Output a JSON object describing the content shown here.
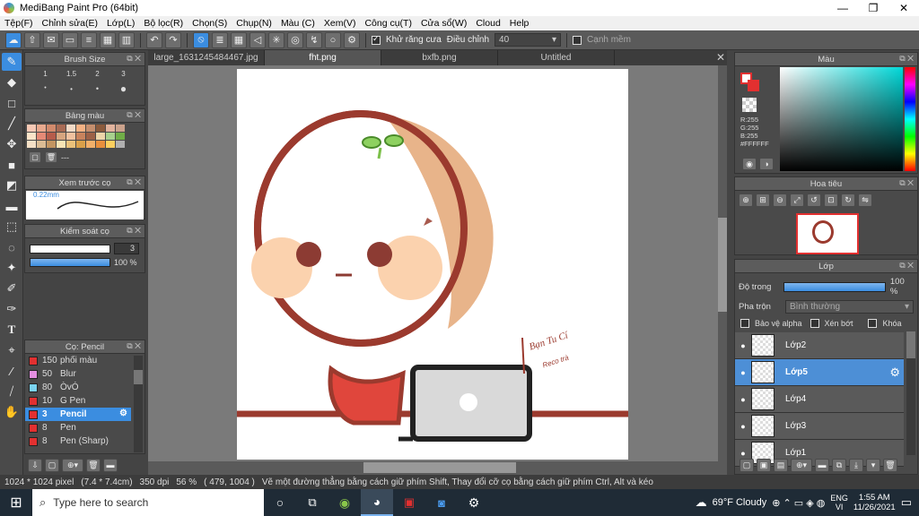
{
  "window": {
    "title": "MediBang Paint Pro (64bit)"
  },
  "menu": [
    "Tệp(F)",
    "Chỉnh sửa(E)",
    "Lớp(L)",
    "Bộ lọc(R)",
    "Chọn(S)",
    "Chụp(N)",
    "Màu (C)",
    "Xem(V)",
    "Công cụ(T)",
    "Cửa sổ(W)",
    "Cloud",
    "Help"
  ],
  "toolbar": {
    "antialias_label": "Khử răng cưa",
    "adjust_label": "Điều chỉnh",
    "adjust_value": "40",
    "snap_label": "Cạnh mềm"
  },
  "brush_size": {
    "title": "Brush Size",
    "sizes": [
      "1",
      "1.5",
      "2",
      "3"
    ]
  },
  "palette": {
    "title": "Bảng màu",
    "dash": "---"
  },
  "brush_preview": {
    "title": "Xem trước cọ",
    "size": "0.22mm"
  },
  "brush_control": {
    "title": "Kiểm soát cọ",
    "width_value": "3",
    "opacity_value": "100 %"
  },
  "brush_list": {
    "title": "Cọ: Pencil",
    "items": [
      {
        "size": "150",
        "name": "phối màu",
        "color": "#e23030"
      },
      {
        "size": "50",
        "name": "Blur",
        "color": "#e38ee0"
      },
      {
        "size": "80",
        "name": "ÒvÓ",
        "color": "#7ad3f0"
      },
      {
        "size": "10",
        "name": "G Pen",
        "color": "#e23030"
      },
      {
        "size": "3",
        "name": "Pencil",
        "color": "#e23030"
      },
      {
        "size": "8",
        "name": "Pen",
        "color": "#e23030"
      },
      {
        "size": "8",
        "name": "Pen (Sharp)",
        "color": "#e23030"
      }
    ]
  },
  "tabs": [
    {
      "label": "large_1631245484467.jpg"
    },
    {
      "label": "fht.png"
    },
    {
      "label": "bxfb.png"
    },
    {
      "label": "Untitled"
    }
  ],
  "canvas": {
    "signature": "Bạn Tu Cí",
    "signature_sub": "Reco trà"
  },
  "color_panel": {
    "title": "Màu",
    "r": "R:255",
    "g": "G:255",
    "b": "B:255",
    "hex": "#FFFFFF"
  },
  "navigator": {
    "title": "Hoa tiêu"
  },
  "layer_panel": {
    "title": "Lớp",
    "opacity_label": "Độ trong",
    "opacity_value": "100 %",
    "blend_label": "Pha trộn",
    "blend_value": "Bình thường",
    "protect_alpha": "Bảo vệ alpha",
    "clipping": "Xén bớt",
    "lock": "Khóa",
    "layers": [
      {
        "name": "Lớp2"
      },
      {
        "name": "Lớp5"
      },
      {
        "name": "Lớp4"
      },
      {
        "name": "Lớp3"
      },
      {
        "name": "Lớp1"
      }
    ]
  },
  "status": {
    "size": "1024 * 1024 pixel",
    "dims": "(7.4 * 7.4cm)",
    "dpi": "350 dpi",
    "zoom": "56 %",
    "coords": "( 479, 1004 )",
    "hint": "Vẽ một đường thẳng bằng cách giữ phím Shift, Thay đổi cỡ cọ bằng cách giữ phím Ctrl, Alt và kéo"
  },
  "taskbar": {
    "search_placeholder": "Type here to search",
    "weather": "69°F Cloudy",
    "lang1": "ENG",
    "lang2": "VI",
    "time": "1:55 AM",
    "date": "11/26/2021"
  },
  "colors": {
    "accent": "#3b8de0",
    "primary_color": "#e23030"
  }
}
